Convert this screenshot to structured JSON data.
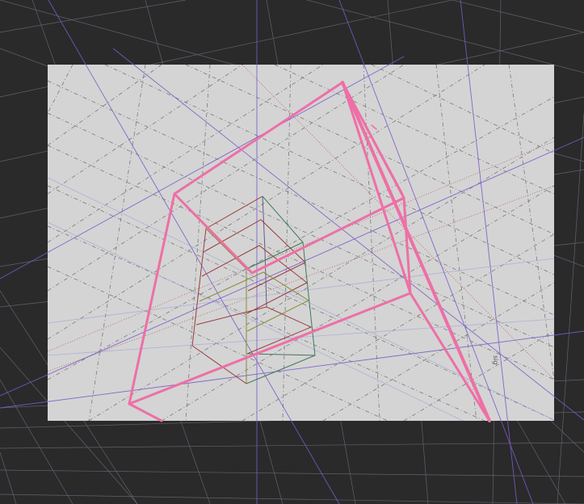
{
  "viewport": {
    "background_color": "#2a2a2a",
    "paper_color": "#d4d4d4",
    "ground_grid_color": "#9a9ab2",
    "perspective_line_color": "#7a5bc9",
    "guide_line_color": "#555555",
    "red_guide_color": "#a33a3a",
    "frame_color": "#ee6fa5",
    "cube_colors": [
      "#9c3a3a",
      "#3e7a5a",
      "#6a5a8a",
      "#8a8a3a"
    ],
    "corner_label": "sig"
  }
}
